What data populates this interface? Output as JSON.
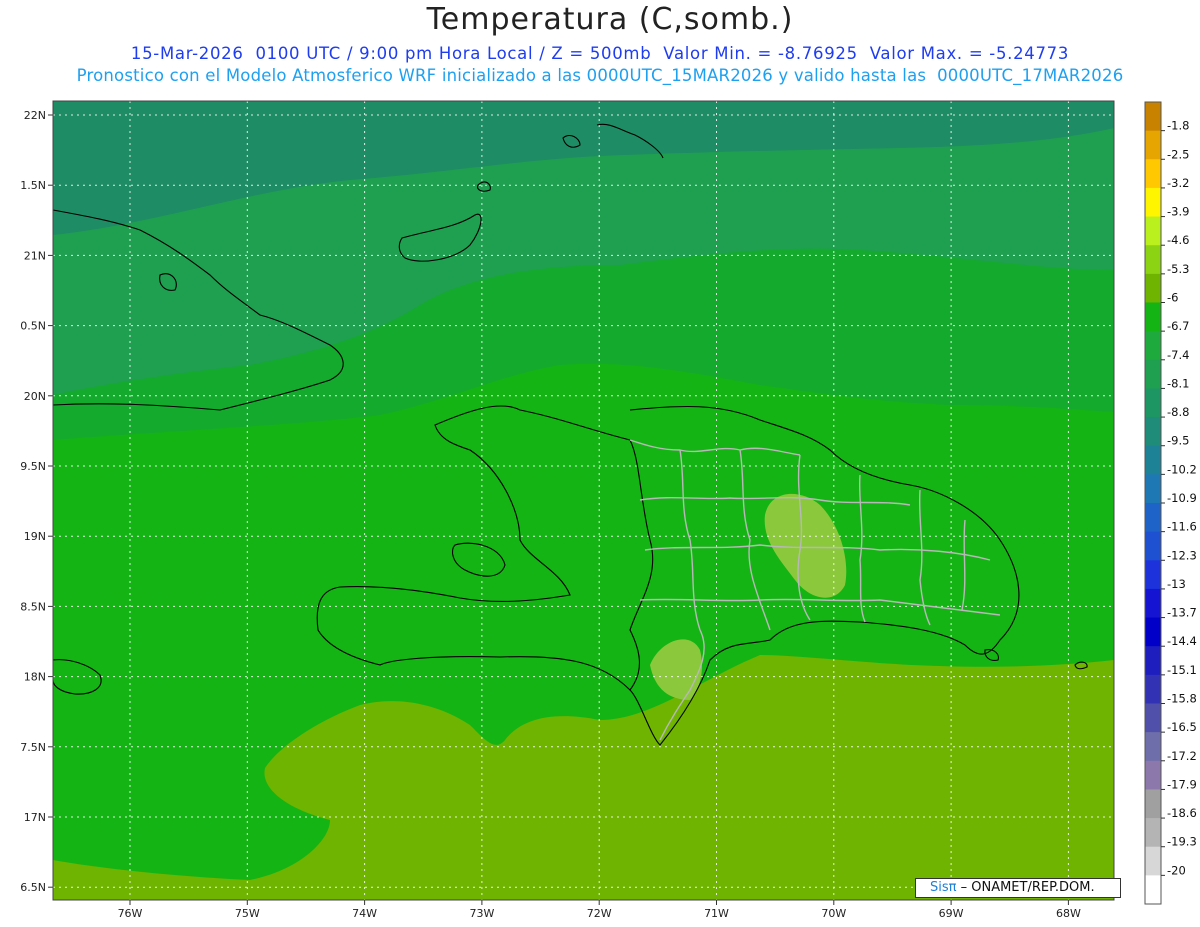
{
  "header": {
    "title": "Temperatura (C,somb.)",
    "line1": "15-Mar-2026  0100 UTC / 9:00 pm Hora Local / Z = 500mb  Valor Min. = -8.76925  Valor Max. = -5.24773",
    "line2": "Pronostico con el Modelo Atmosferico WRF inicializado a las 0000UTC_15MAR2026 y valido hasta las  0000UTC_17MAR2026"
  },
  "axes": {
    "lat_labels": [
      "22N",
      "1.5N",
      "21N",
      "0.5N",
      "20N",
      "9.5N",
      "19N",
      "8.5N",
      "18N",
      "7.5N",
      "17N",
      "6.5N"
    ],
    "lon_labels": [
      "76W",
      "75W",
      "74W",
      "73W",
      "72W",
      "71W",
      "70W",
      "69W",
      "68W"
    ]
  },
  "colorbar": {
    "labels": [
      "-1.8",
      "-2.5",
      "-3.2",
      "-3.9",
      "-4.6",
      "-5.3",
      "-6",
      "-6.7",
      "-7.4",
      "-8.1",
      "-8.8",
      "-9.5",
      "-10.2",
      "-10.9",
      "-11.6",
      "-12.3",
      "-13",
      "-13.7",
      "-14.4",
      "-15.1",
      "-15.8",
      "-16.5",
      "-17.2",
      "-17.9",
      "-18.6",
      "-19.3",
      "-20"
    ],
    "colors": [
      "#c88200",
      "#e6a500",
      "#ffc800",
      "#fff500",
      "#b9f01e",
      "#8cd314",
      "#6eb400",
      "#14b414",
      "#1eaa3c",
      "#1ea050",
      "#1e9664",
      "#1e8c78",
      "#1e8296",
      "#1e78b4",
      "#1e64c8",
      "#1e50d2",
      "#1e32dc",
      "#1414d2",
      "#0000c8",
      "#1e1ebe",
      "#3232b4",
      "#5050aa",
      "#6e6eaa",
      "#8c78aa",
      "#a0a0a0",
      "#b4b4b4",
      "#d7d7d7",
      "#ffffff"
    ]
  },
  "field_colors": {
    "north": "#1e8c64",
    "band2": "#1ea050",
    "band3": "#14aa2d",
    "band4": "#14b414",
    "south": "#6eb400",
    "warm_spot": "#8cc83c"
  },
  "credit": {
    "brand": "Sisπ",
    "org": " – ONAMET/REP.DOM."
  }
}
